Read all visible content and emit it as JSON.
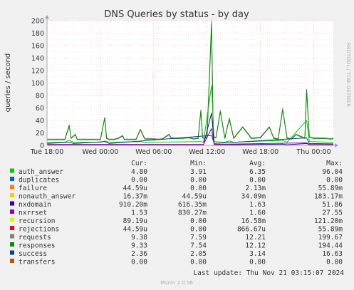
{
  "watermark": "RRDTOOL / TOBI OETIKER",
  "footer": {
    "last_update": "Last update: Thu Nov 21 03:15:07 2024",
    "version": "Munin 2.0.56"
  },
  "legend_table": {
    "headers": [
      "Cur:",
      "Min:",
      "Avg:",
      "Max:"
    ],
    "rows": [
      {
        "name": "auth_answer",
        "color": "#00cc00",
        "cur": "4.80",
        "min": "3.91",
        "avg": "6.35",
        "max": "96.04"
      },
      {
        "name": "duplicates",
        "color": "#0066b3",
        "cur": "0.00",
        "min": "0.00",
        "avg": "0.00",
        "max": "0.00"
      },
      {
        "name": "failure",
        "color": "#ff8000",
        "cur": "44.59u",
        "min": "0.00",
        "avg": "2.13m",
        "max": "55.89m"
      },
      {
        "name": "nonauth_answer",
        "color": "#ffcc00",
        "cur": "16.37m",
        "min": "44.59u",
        "avg": "34.09m",
        "max": "183.17m"
      },
      {
        "name": "nxdomain",
        "color": "#330099",
        "cur": "910.20m",
        "min": "616.35m",
        "avg": "1.63",
        "max": "51.86"
      },
      {
        "name": "nxrrset",
        "color": "#990099",
        "cur": "1.53",
        "min": "830.27m",
        "avg": "1.60",
        "max": "27.55"
      },
      {
        "name": "recursion",
        "color": "#ccff00",
        "cur": "89.19u",
        "min": "0.00",
        "avg": "16.58m",
        "max": "121.20m"
      },
      {
        "name": "rejections",
        "color": "#ff0000",
        "cur": "44.59u",
        "min": "0.00",
        "avg": "866.67u",
        "max": "55.89m"
      },
      {
        "name": "requests",
        "color": "#808080",
        "cur": "9.38",
        "min": "7.59",
        "avg": "12.21",
        "max": "199.67"
      },
      {
        "name": "responses",
        "color": "#008f00",
        "cur": "9.33",
        "min": "7.54",
        "avg": "12.12",
        "max": "194.44"
      },
      {
        "name": "success",
        "color": "#00487d",
        "cur": "2.36",
        "min": "2.05",
        "avg": "3.14",
        "max": "16.63"
      },
      {
        "name": "transfers",
        "color": "#b35a00",
        "cur": "0.00",
        "min": "0.00",
        "avg": "0.00",
        "max": "0.00"
      }
    ]
  },
  "chart_data": {
    "type": "line",
    "title": "DNS Queries by status - by day",
    "ylabel": "queries / second",
    "ylim": [
      0,
      200
    ],
    "yticks": [
      0,
      20,
      40,
      60,
      80,
      100,
      120,
      140,
      160,
      180,
      200
    ],
    "xlim": [
      0,
      32.2
    ],
    "xticks": [
      {
        "label": "Tue 18:00",
        "x": 0
      },
      {
        "label": "Wed 00:00",
        "x": 6
      },
      {
        "label": "Wed 06:00",
        "x": 12
      },
      {
        "label": "Wed 12:00",
        "x": 18
      },
      {
        "label": "Wed 18:00",
        "x": 24
      },
      {
        "label": "Thu 00:00",
        "x": 30
      }
    ],
    "grid": true,
    "series": [
      {
        "name": "requests",
        "color": "#808080",
        "x": [
          0,
          1,
          2,
          2.5,
          2.7,
          3.2,
          3.4,
          4,
          6,
          6.5,
          6.7,
          7,
          7.5,
          8,
          8.5,
          8.7,
          10,
          10.5,
          11,
          12,
          12.5,
          13,
          13.4,
          13.7,
          14,
          15,
          16,
          16.5,
          17,
          17.3,
          17.5,
          17.7,
          18,
          18.5,
          18.7,
          19,
          19.5,
          20,
          20.5,
          21,
          22,
          23,
          24,
          25,
          25.5,
          26,
          26.5,
          27,
          27.5,
          28,
          29,
          29.2,
          29.5,
          30,
          31,
          32,
          32.2
        ],
        "y": [
          10,
          10,
          10,
          33,
          12,
          18,
          10,
          10,
          10,
          45,
          12,
          10,
          10,
          12,
          16,
          10,
          10,
          26,
          11,
          11,
          10,
          11,
          15,
          18,
          12,
          12,
          13,
          11,
          12,
          57,
          13,
          12,
          14,
          200,
          14,
          13,
          56,
          12,
          44,
          12,
          30,
          12,
          13,
          30,
          12,
          11,
          59,
          12,
          11,
          18,
          12,
          90,
          14,
          12,
          12,
          11,
          12
        ]
      },
      {
        "name": "responses",
        "color": "#008f00",
        "x": [
          0,
          1,
          2,
          2.5,
          2.7,
          3.2,
          3.4,
          4,
          6,
          6.5,
          6.7,
          7,
          7.5,
          8,
          8.5,
          8.7,
          10,
          10.5,
          11,
          12,
          12.5,
          13,
          13.4,
          13.7,
          14,
          15,
          16,
          16.5,
          17,
          17.3,
          17.5,
          17.7,
          18,
          18.5,
          18.7,
          19,
          19.5,
          20,
          20.5,
          21,
          22,
          23,
          24,
          25,
          25.5,
          26,
          26.5,
          27,
          27.5,
          28,
          29,
          29.2,
          29.5,
          30,
          31,
          32,
          32.2
        ],
        "y": [
          9,
          9,
          9,
          31,
          11,
          17,
          9,
          9,
          9,
          44,
          11,
          9,
          9,
          11,
          15,
          9,
          9,
          25,
          10,
          10,
          9,
          10,
          14,
          17,
          11,
          11,
          12,
          10,
          11,
          55,
          12,
          11,
          13,
          194,
          13,
          12,
          54,
          11,
          42,
          11,
          29,
          11,
          12,
          29,
          11,
          10,
          57,
          11,
          10,
          17,
          11,
          88,
          13,
          11,
          11,
          10,
          11
        ]
      },
      {
        "name": "auth_answer",
        "color": "#00cc00",
        "x": [
          0,
          2,
          2.5,
          3,
          6,
          6.5,
          7,
          10.5,
          11,
          17.3,
          17.6,
          18.5,
          18.8,
          20,
          20.5,
          21,
          26.5,
          27,
          29.2,
          29.5,
          32.2
        ],
        "y": [
          5,
          5,
          8,
          5,
          5,
          7,
          5,
          6,
          5,
          6,
          5,
          96,
          6,
          5,
          7,
          5,
          8,
          5,
          40,
          6,
          5
        ]
      },
      {
        "name": "nxdomain",
        "color": "#330099",
        "x": [
          0,
          6.5,
          7,
          17.3,
          17.6,
          18.5,
          18.8,
          20,
          26.5,
          27,
          29.2,
          29.5,
          32.2
        ],
        "y": [
          1,
          1,
          1,
          1,
          1,
          52,
          1,
          1,
          2,
          1,
          3,
          1,
          1
        ]
      },
      {
        "name": "nxrrset",
        "color": "#990099",
        "x": [
          0,
          17.3,
          17.6,
          18.5,
          18.8,
          29.2,
          29.5,
          32.2
        ],
        "y": [
          1.6,
          1.6,
          1.6,
          27,
          1.6,
          4,
          1.6,
          1.5
        ]
      },
      {
        "name": "success",
        "color": "#00487d",
        "x": [
          0,
          2.5,
          3,
          6.5,
          7,
          18.5,
          18.8,
          29.2,
          29.5,
          32.2
        ],
        "y": [
          3,
          5,
          3,
          6,
          3,
          16,
          3,
          12,
          3,
          2.4
        ]
      }
    ]
  }
}
